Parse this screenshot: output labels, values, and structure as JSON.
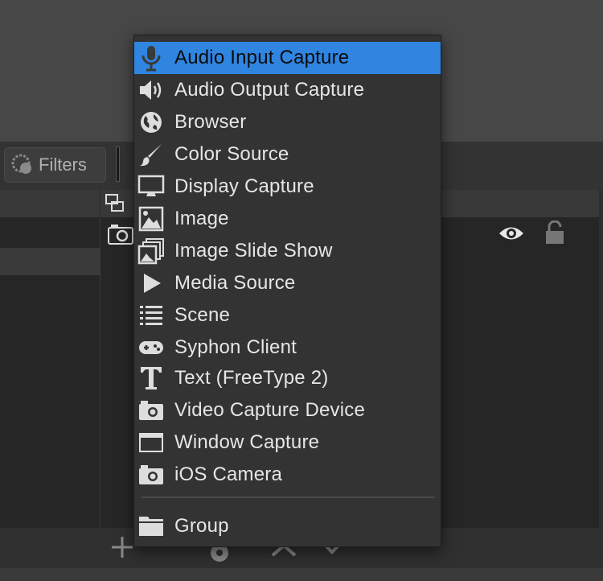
{
  "toolbar": {
    "filters_label": "Filters"
  },
  "menu": {
    "items": [
      {
        "label": "Audio Input Capture",
        "icon": "microphone-icon",
        "selected": true
      },
      {
        "label": "Audio Output Capture",
        "icon": "speaker-icon"
      },
      {
        "label": "Browser",
        "icon": "globe-icon"
      },
      {
        "label": "Color Source",
        "icon": "paintbrush-icon"
      },
      {
        "label": "Display Capture",
        "icon": "monitor-icon"
      },
      {
        "label": "Image",
        "icon": "image-icon"
      },
      {
        "label": "Image Slide Show",
        "icon": "slideshow-icon"
      },
      {
        "label": "Media Source",
        "icon": "play-icon"
      },
      {
        "label": "Scene",
        "icon": "list-icon"
      },
      {
        "label": "Syphon Client",
        "icon": "gamepad-icon"
      },
      {
        "label": "Text (FreeType 2)",
        "icon": "text-icon"
      },
      {
        "label": "Video Capture Device",
        "icon": "camera-icon"
      },
      {
        "label": "Window Capture",
        "icon": "window-icon"
      },
      {
        "label": "iOS Camera",
        "icon": "camera-icon"
      }
    ],
    "group": {
      "label": "Group",
      "icon": "folder-icon"
    }
  },
  "colors": {
    "selected_bg": "#2f85e0",
    "menu_bg": "#333333",
    "text": "#e6e6e6"
  }
}
